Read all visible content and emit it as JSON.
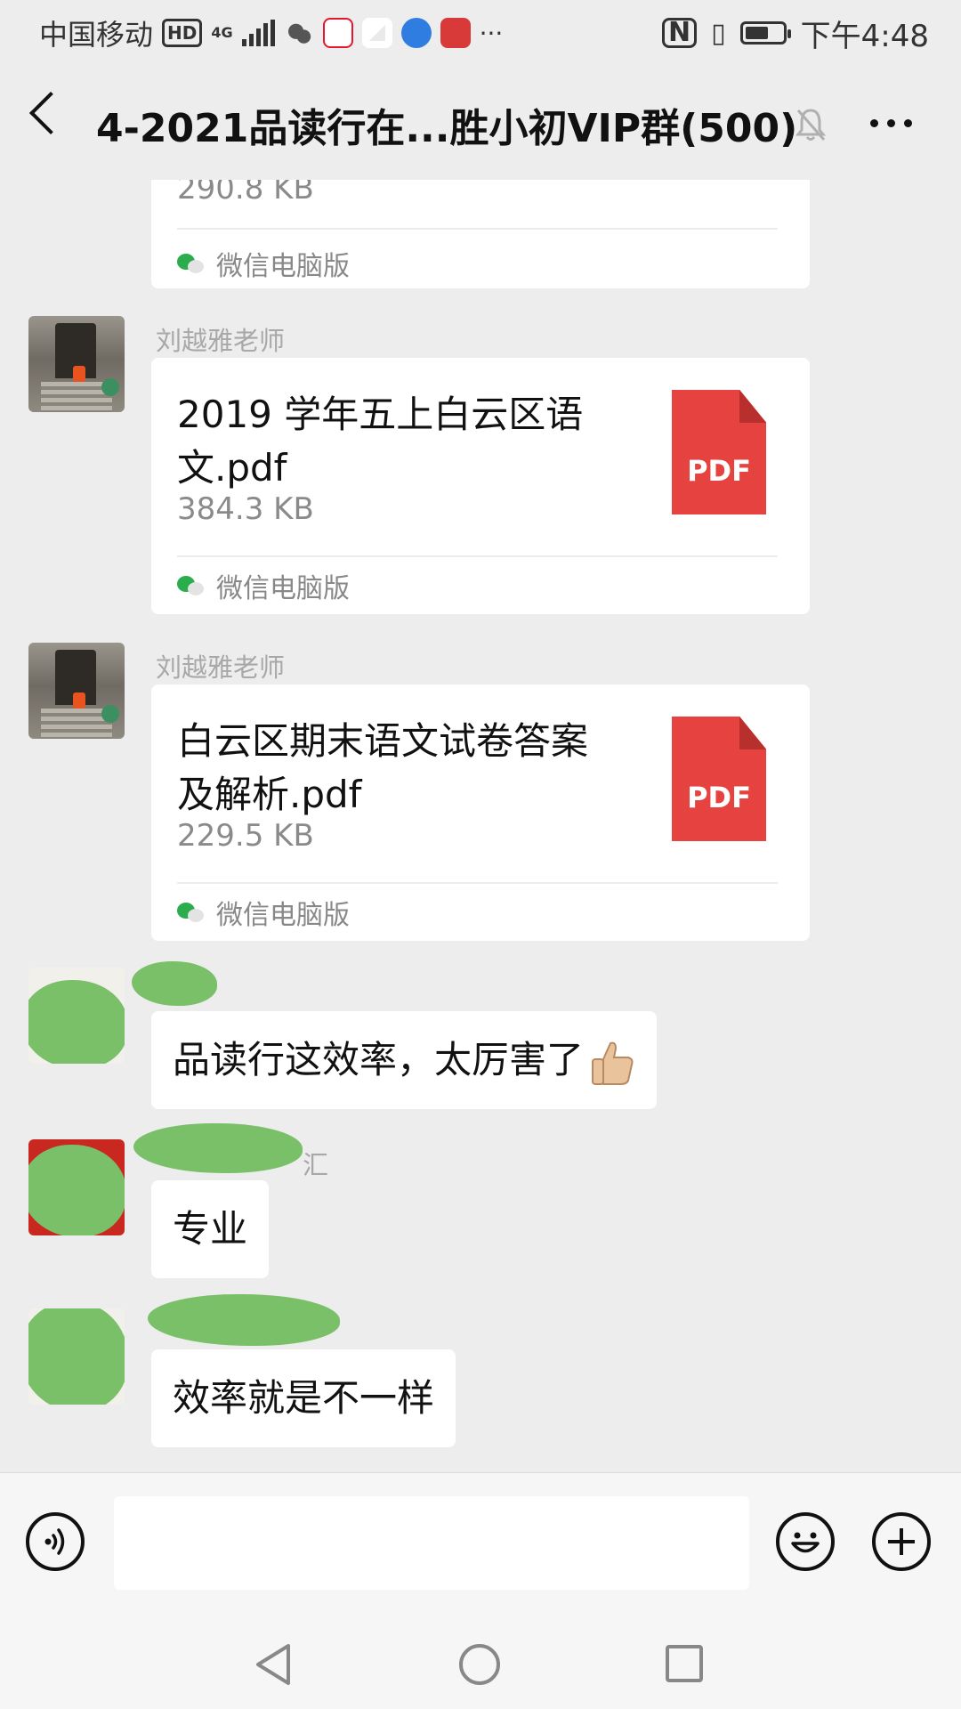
{
  "status_bar": {
    "carrier": "中国移动",
    "hd": "HD",
    "network": "4G",
    "time": "下午4:48",
    "battery_level": 0.55,
    "app_icons": [
      "wechat-icon",
      "weibo-icon",
      "maps-icon",
      "music-icon",
      "book-icon"
    ],
    "more": "···"
  },
  "header": {
    "title": "4-2021品读行在...胜小初VIP群(500)"
  },
  "messages": [
    {
      "type": "file",
      "file_size": "290.8 KB",
      "source": "微信电脑版"
    },
    {
      "type": "file",
      "sender": "刘越雅老师",
      "file_name": "2019 学年五上白云区语文.pdf",
      "file_size": "384.3 KB",
      "file_type": "PDF",
      "source": "微信电脑版"
    },
    {
      "type": "file",
      "sender": "刘越雅老师",
      "file_name": "白云区期末语文试卷答案及解析.pdf",
      "file_size": "229.5 KB",
      "file_type": "PDF",
      "source": "微信电脑版"
    },
    {
      "type": "text",
      "text": "品读行这效率，太厉害了"
    },
    {
      "type": "text",
      "sender_fragment": "汇",
      "text": "专业"
    },
    {
      "type": "text",
      "text": "效率就是不一样"
    }
  ],
  "input": {
    "value": ""
  },
  "colors": {
    "background": "#ededed",
    "pdf": "#e64340",
    "wechat_green": "#07c160"
  }
}
